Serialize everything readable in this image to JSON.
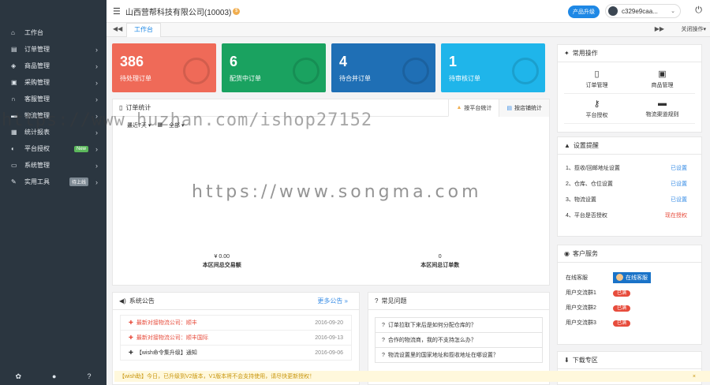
{
  "sidebar": {
    "items": [
      {
        "icon": "home-icon",
        "glyph": "⌂",
        "label": "工作台"
      },
      {
        "icon": "cart-icon",
        "glyph": "▤",
        "label": "订单管理"
      },
      {
        "icon": "box-icon",
        "glyph": "◈",
        "label": "商品管理"
      },
      {
        "icon": "purchase-icon",
        "glyph": "▣",
        "label": "采购管理"
      },
      {
        "icon": "headset-icon",
        "glyph": "∩",
        "label": "客服管理"
      },
      {
        "icon": "truck-icon",
        "glyph": "▬",
        "label": "物流管理"
      },
      {
        "icon": "report-icon",
        "glyph": "▦",
        "label": "统计报表"
      },
      {
        "icon": "plug-icon",
        "glyph": "◐",
        "label": "平台授权",
        "badge": "New"
      },
      {
        "icon": "monitor-icon",
        "glyph": "▭",
        "label": "系统管理"
      },
      {
        "icon": "wrench-icon",
        "glyph": "✎",
        "label": "实用工具",
        "badge": "待上线"
      }
    ],
    "bottom_icons": [
      "settings-icon",
      "help-icon",
      "question-icon"
    ]
  },
  "topbar": {
    "company": "山西营帮科技有限公司(10003)",
    "upgrade_label": "产品升级",
    "username": "c329e9caa...",
    "power_icon": "power-icon"
  },
  "tabbar": {
    "active_tab": "工作台",
    "close_ops": "关闭操作"
  },
  "cards": [
    {
      "value": "386",
      "label": "待处理订单",
      "color": "#ef6a58"
    },
    {
      "value": "6",
      "label": "配货中订单",
      "color": "#1aa260"
    },
    {
      "value": "4",
      "label": "待合并订单",
      "color": "#1f6fb5"
    },
    {
      "value": "1",
      "label": "待审核订单",
      "color": "#1fb5ea"
    }
  ],
  "order_stats": {
    "title": "订单统计",
    "tab_platform": "按平台统计",
    "tab_shop": "按店铺统计",
    "filters": [
      "最近7天",
      "",
      "全部"
    ],
    "amount_value": "¥ 0.00",
    "amount_label": "本区间总交易额",
    "count_value": "0",
    "count_label": "本区间总订单数"
  },
  "announcements": {
    "title": "系统公告",
    "more": "更多公告 »",
    "items": [
      {
        "text": "最新对接物流公司：顺丰",
        "date": "2016-09-20"
      },
      {
        "text": "最新对接物流公司：顺丰国际",
        "date": "2016-09-13"
      },
      {
        "text": "【wish命令集升级】通知",
        "date": "2016-09-06"
      }
    ]
  },
  "faq": {
    "title": "常见问题",
    "items": [
      "订单拉取下来后是如何分配仓库的？",
      "合作的物流商，我的不支持怎么办？",
      "物流设置里的国家地址和揽收地址在哪设置？"
    ]
  },
  "quick_ops": {
    "title": "常用操作",
    "items": [
      {
        "icon": "file-icon",
        "glyph": "▯",
        "label": "订单管理"
      },
      {
        "icon": "gift-icon",
        "glyph": "▣",
        "label": "商品管理"
      },
      {
        "icon": "key-icon",
        "glyph": "⚷",
        "label": "平台授权"
      },
      {
        "icon": "truck-icon",
        "glyph": "▬",
        "label": "物流渠道规则"
      }
    ]
  },
  "settings_reminder": {
    "title": "设置提醒",
    "items": [
      {
        "label": "1、揽收/回邮地址设置",
        "status": "已设置",
        "ok": true
      },
      {
        "label": "2、仓库、仓位设置",
        "status": "已设置",
        "ok": true
      },
      {
        "label": "3、物流设置",
        "status": "已设置",
        "ok": true
      },
      {
        "label": "4、平台是否授权",
        "status": "现在授权",
        "ok": false
      }
    ]
  },
  "customer_service": {
    "title": "客户服务",
    "online_label": "在线客服",
    "online_button": "在线客服",
    "groups": [
      {
        "label": "用户交流群1",
        "value": "已满"
      },
      {
        "label": "用户交流群2",
        "value": "已满"
      },
      {
        "label": "用户交流群3",
        "value": "已满"
      }
    ]
  },
  "download": {
    "title": "下载专区"
  },
  "notice": "【wish助】今日，已升级到V2版本，V1版本将不会支持使用，请尽快更新授权！",
  "watermarks": [
    "https://www.huzhan.com/ishop27152",
    "https://www.songma.com"
  ]
}
